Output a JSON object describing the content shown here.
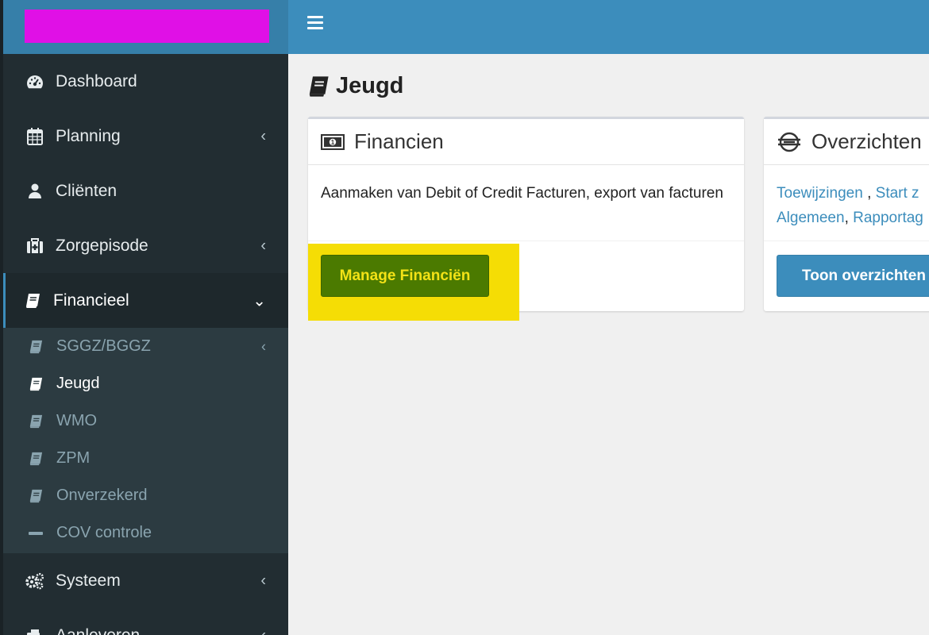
{
  "colors": {
    "logo_block": "#e010e6",
    "header": "#3c8dbc",
    "sidebar": "#222d32",
    "highlight": "#f5dd05",
    "success": "#4b7a00",
    "link": "#3c8dbc"
  },
  "sidebar": {
    "items": [
      {
        "label": "Dashboard",
        "icon": "dashboard-icon"
      },
      {
        "label": "Planning",
        "icon": "calendar-icon"
      },
      {
        "label": "Cliënten",
        "icon": "user-icon"
      },
      {
        "label": "Zorgepisode",
        "icon": "medkit-icon"
      },
      {
        "label": "Financieel",
        "icon": "book-icon"
      },
      {
        "label": "Systeem",
        "icon": "cogs-icon"
      },
      {
        "label": "Aanleveren",
        "icon": "send-icon"
      }
    ],
    "submenu": [
      {
        "label": "SGGZ/BGGZ",
        "icon": "book-icon"
      },
      {
        "label": "Jeugd",
        "icon": "book-icon"
      },
      {
        "label": "WMO",
        "icon": "book-icon"
      },
      {
        "label": "ZPM",
        "icon": "book-icon"
      },
      {
        "label": "Onverzekerd",
        "icon": "book-icon"
      },
      {
        "label": "COV controle",
        "icon": "minus-icon"
      }
    ]
  },
  "page": {
    "title": "Jeugd"
  },
  "boxes": {
    "financien": {
      "title": "Financien",
      "body": "Aanmaken van Debit of Credit Facturen, export van facturen",
      "button": "Manage Financiën"
    },
    "overzichten": {
      "title": "Overzichten",
      "link1": "Toewijzingen",
      "sep1": " , ",
      "link2": "Start z",
      "link3": "Algemeen",
      "sep2": ", ",
      "link4": "Rapportag",
      "button": "Toon overzichten"
    }
  }
}
